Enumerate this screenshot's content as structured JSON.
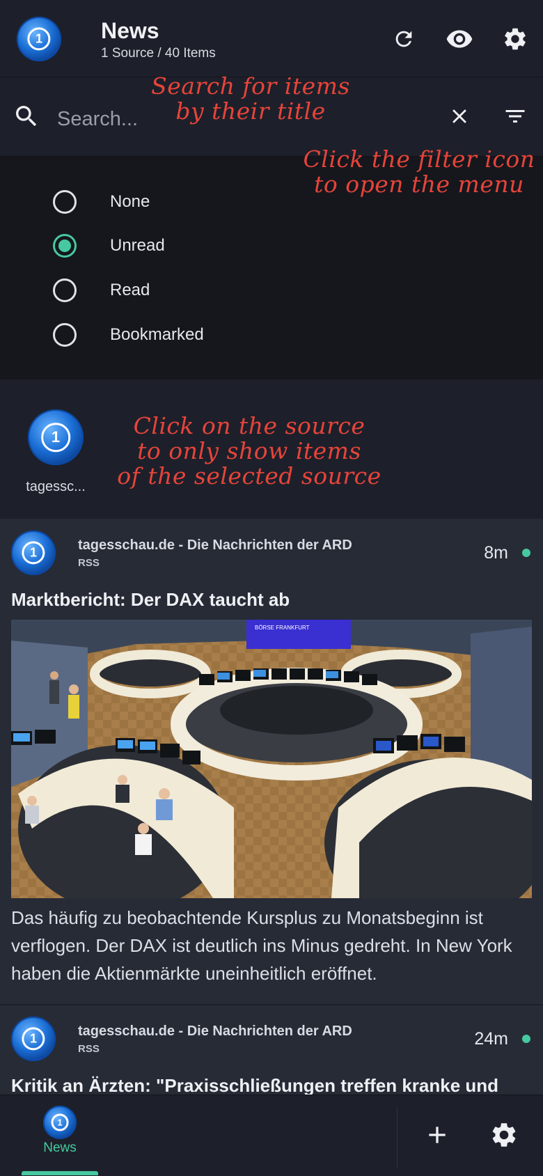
{
  "header": {
    "title": "News",
    "subtitle": "1 Source / 40 Items",
    "icons": [
      "refresh-icon",
      "eye-icon",
      "gear-icon"
    ]
  },
  "search": {
    "placeholder": "Search...",
    "icons": [
      "search-icon",
      "close-icon",
      "filter-icon"
    ]
  },
  "filter": {
    "options": [
      {
        "label": "None",
        "selected": false
      },
      {
        "label": "Unread",
        "selected": true
      },
      {
        "label": "Read",
        "selected": false
      },
      {
        "label": "Bookmarked",
        "selected": false
      }
    ]
  },
  "sources": [
    {
      "label": "tagessc..."
    }
  ],
  "annotations": {
    "search": [
      "Search for items",
      "by their title"
    ],
    "filter": [
      "Click the filter icon",
      "to open the menu"
    ],
    "source": [
      "Click on the source",
      "to only show items",
      "of the selected source"
    ]
  },
  "articles": [
    {
      "source": "tagesschau.de - Die Nachrichten der ARD",
      "type": "RSS",
      "time": "8m",
      "unread": true,
      "title": "Marktbericht: Der DAX taucht ab",
      "image_caption": "BÖRSE FRANKFURT",
      "description": "Das häufig zu beobachtende Kursplus zu Monatsbeginn ist verflogen. Der DAX ist deutlich ins Minus gedreht. In New York haben die Aktienmärkte uneinheitlich eröffnet."
    },
    {
      "source": "tagesschau.de - Die Nachrichten der ARD",
      "type": "RSS",
      "time": "24m",
      "unread": true,
      "title": "Kritik an Ärzten: \"Praxisschließungen treffen kranke und"
    }
  ],
  "bottom_nav": {
    "active_label": "News",
    "icons": [
      "add-icon",
      "gear-icon"
    ]
  },
  "colors": {
    "accent": "#46c9a0",
    "annotation": "#e7443a",
    "background": "#1d202a",
    "card": "#272b36"
  }
}
